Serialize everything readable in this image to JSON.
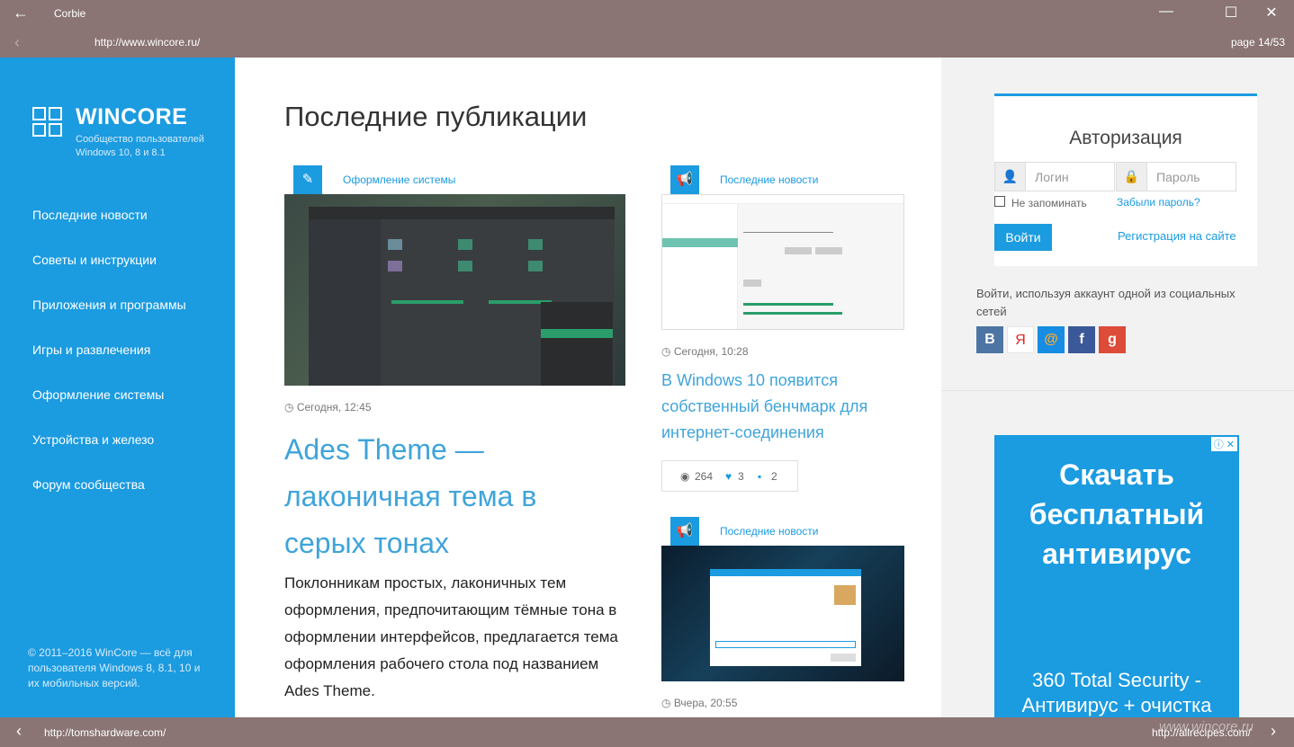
{
  "window": {
    "title": "Corbie",
    "back_icon": "back-arrow-icon"
  },
  "address": {
    "url": "http://www.wincore.ru/",
    "page_indicator": "page 14/53"
  },
  "bottom": {
    "left_url": "http://tomshardware.com/",
    "right_url": "http://allrecipes.com/"
  },
  "sidebar": {
    "brand": "WINCORE",
    "subtitle": "Сообщество пользователей Windows 10, 8 и 8.1",
    "items": [
      {
        "label": "Последние новости"
      },
      {
        "label": "Советы и инструкции"
      },
      {
        "label": "Приложения и программы"
      },
      {
        "label": "Игры и развлечения"
      },
      {
        "label": "Оформление системы"
      },
      {
        "label": "Устройства и железо"
      },
      {
        "label": "Форум сообщества"
      }
    ],
    "copyright": "© 2011–2016 WinCore — всё для пользователя Windows 8, 8.1, 10 и их мобильных версий."
  },
  "main": {
    "heading": "Последние публикации",
    "featured": {
      "category": "Оформление системы",
      "time": "Сегодня, 12:45",
      "title": "Ades Theme — лаконичная тема в серых тонах",
      "excerpt": "Поклонникам простых, лаконичных тем оформления, предпочитающим тёмные тона в оформлении интерфейсов, предлагается тема оформления рабочего стола под названием Ades Theme."
    },
    "news1": {
      "category": "Последние новости",
      "time": "Сегодня, 10:28",
      "title": "В Windows 10 появится собственный бенчмарк для интернет-соединения",
      "views": "264",
      "likes": "3",
      "comments": "2"
    },
    "news2": {
      "category": "Последние новости",
      "time": "Вчера, 20:55"
    }
  },
  "auth": {
    "title": "Авторизация",
    "login_placeholder": "Логин",
    "password_placeholder": "Пароль",
    "remember_label": "Не запоминать",
    "forgot_link": "Забыли пароль?",
    "login_button": "Войти",
    "register_link": "Регистрация на сайте",
    "social_text": "Войти, используя аккаунт одной из социальных сетей",
    "social": [
      {
        "label": "В",
        "color": "#4c75a3"
      },
      {
        "label": "Я",
        "color": "#ffffff"
      },
      {
        "label": "@",
        "color": "#168de2"
      },
      {
        "label": "f",
        "color": "#3b5998"
      },
      {
        "label": "g",
        "color": "#dd4b39"
      }
    ]
  },
  "ad": {
    "headline": "Скачать бесплатный антивирус",
    "sub": "360 Total Security - Антивирус + очистка"
  },
  "watermark": "www.wincore.ru"
}
